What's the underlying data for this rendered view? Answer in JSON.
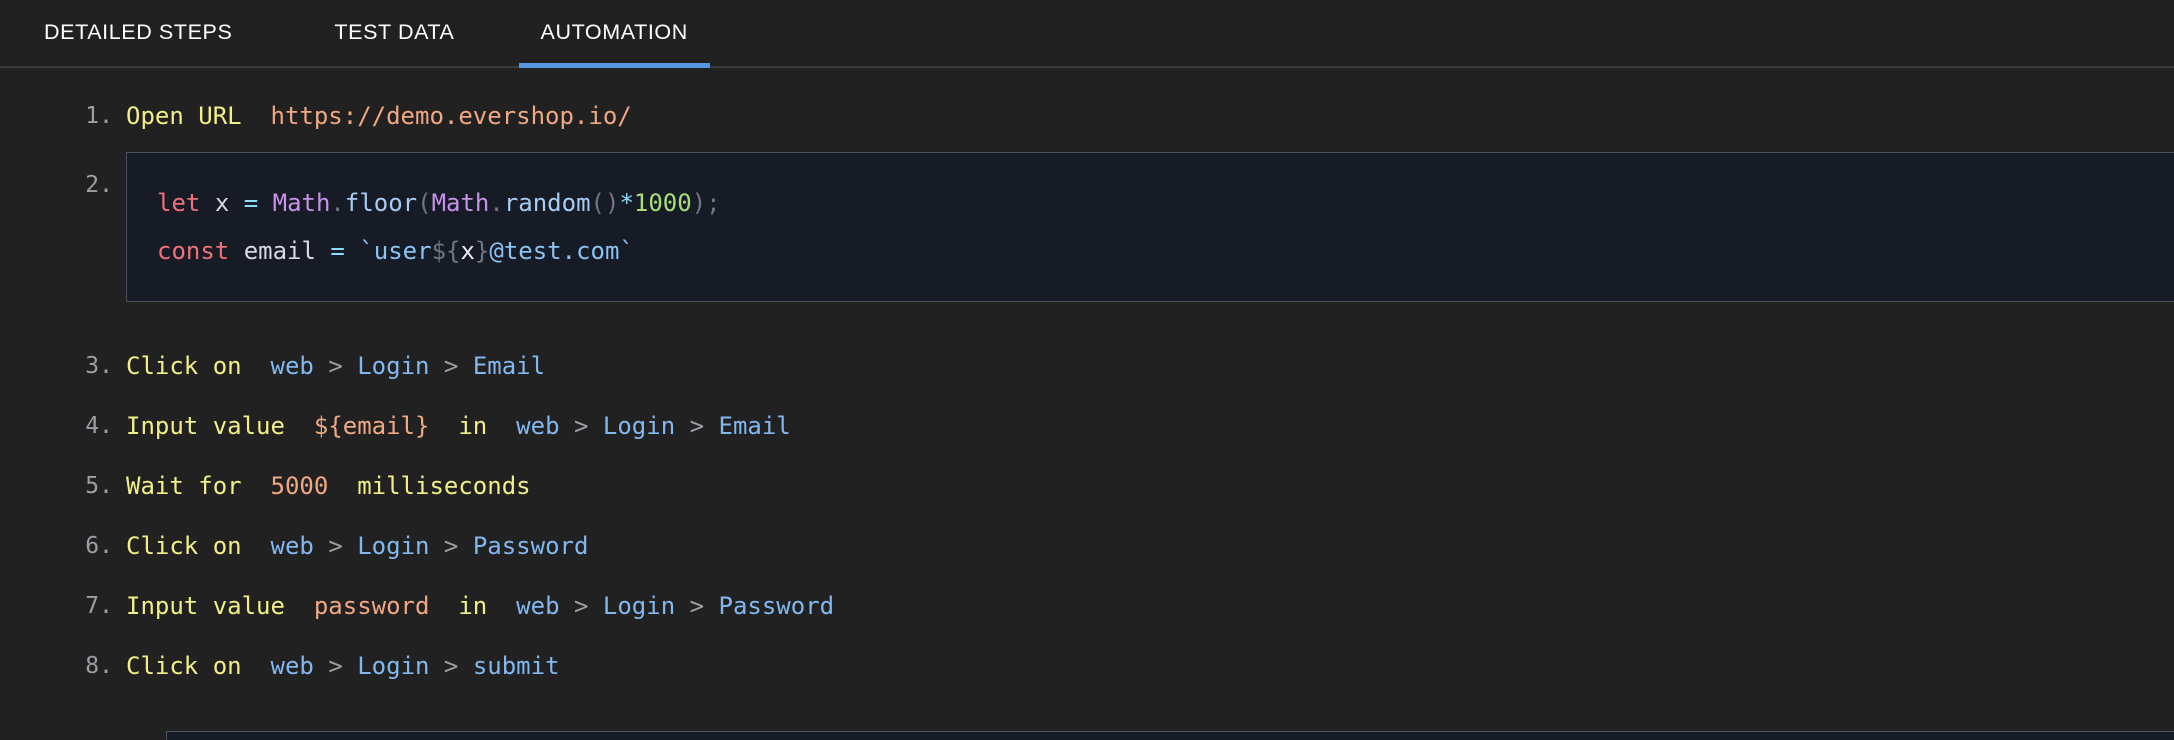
{
  "tabs": [
    {
      "label": "DETAILED STEPS",
      "active": false
    },
    {
      "label": "TEST DATA",
      "active": false
    },
    {
      "label": "AUTOMATION",
      "active": true
    }
  ],
  "colors": {
    "page_background": "#212121",
    "code_background": "#171b26",
    "code_border": "#4c5360",
    "tab_underline_accent": "#5496e0",
    "step_number": "#9aa0a6",
    "action_keyword": "#f2ef86",
    "literal_value": "#f0a882",
    "selector": "#82b8f0",
    "separator": "#9aa0a6"
  },
  "steps": [
    {
      "number": "1.",
      "type": "action",
      "action": "Open URL",
      "value": "https://demo.evershop.io/"
    },
    {
      "number": "2.",
      "type": "code",
      "lines": [
        {
          "tokens": [
            {
              "t": "let",
              "c": "c-kw"
            },
            {
              "t": " ",
              "c": "c-pnc"
            },
            {
              "t": "x",
              "c": "c-var"
            },
            {
              "t": " ",
              "c": "c-pnc"
            },
            {
              "t": "=",
              "c": "c-op"
            },
            {
              "t": " ",
              "c": "c-pnc"
            },
            {
              "t": "Math",
              "c": "c-obj"
            },
            {
              "t": ".",
              "c": "c-pnc"
            },
            {
              "t": "floor",
              "c": "c-fn"
            },
            {
              "t": "(",
              "c": "c-pnc"
            },
            {
              "t": "Math",
              "c": "c-obj"
            },
            {
              "t": ".",
              "c": "c-pnc"
            },
            {
              "t": "random",
              "c": "c-fn"
            },
            {
              "t": "()",
              "c": "c-pnc"
            },
            {
              "t": "*",
              "c": "c-op"
            },
            {
              "t": "1000",
              "c": "c-num"
            },
            {
              "t": ")",
              "c": "c-pnc"
            },
            {
              "t": ";",
              "c": "c-pnc"
            }
          ]
        },
        {
          "tokens": [
            {
              "t": "const",
              "c": "c-kw"
            },
            {
              "t": " ",
              "c": "c-pnc"
            },
            {
              "t": "email",
              "c": "c-var"
            },
            {
              "t": " ",
              "c": "c-pnc"
            },
            {
              "t": "=",
              "c": "c-op"
            },
            {
              "t": " ",
              "c": "c-pnc"
            },
            {
              "t": "`user",
              "c": "c-str"
            },
            {
              "t": "${",
              "c": "c-pnc"
            },
            {
              "t": "x",
              "c": "c-wht"
            },
            {
              "t": "}",
              "c": "c-pnc"
            },
            {
              "t": "@test.com`",
              "c": "c-str"
            }
          ]
        }
      ],
      "raw_code": "let x = Math.floor(Math.random()*1000);\nconst email = `user${x}@test.com`"
    },
    {
      "number": "3.",
      "type": "action",
      "action": "Click on",
      "selector": [
        "web",
        "Login",
        "Email"
      ]
    },
    {
      "number": "4.",
      "type": "action",
      "action": "Input value",
      "value": "${email}",
      "preposition": "in",
      "selector": [
        "web",
        "Login",
        "Email"
      ]
    },
    {
      "number": "5.",
      "type": "action",
      "action": "Wait for",
      "value": "5000",
      "suffix": "milliseconds"
    },
    {
      "number": "6.",
      "type": "action",
      "action": "Click on",
      "selector": [
        "web",
        "Login",
        "Password"
      ]
    },
    {
      "number": "7.",
      "type": "action",
      "action": "Input value",
      "value": "password",
      "preposition": "in",
      "selector": [
        "web",
        "Login",
        "Password"
      ]
    },
    {
      "number": "8.",
      "type": "action",
      "action": "Click on",
      "selector": [
        "web",
        "Login",
        "submit"
      ]
    }
  ],
  "separator_glyph": ">"
}
